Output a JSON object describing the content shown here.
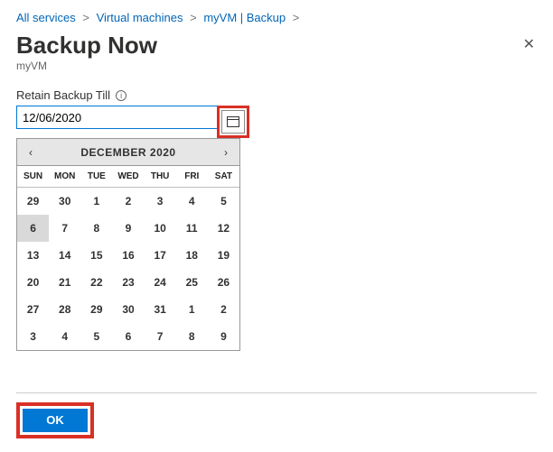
{
  "breadcrumb": {
    "items": [
      "All services",
      "Virtual machines",
      "myVM | Backup"
    ],
    "sep": ">"
  },
  "title": "Backup Now",
  "subtitle": "myVM",
  "close_label": "✕",
  "field": {
    "label": "Retain Backup Till",
    "info_glyph": "i",
    "value": "12/06/2020"
  },
  "calendar": {
    "month_label": "DECEMBER 2020",
    "prev_glyph": "‹",
    "next_glyph": "›",
    "dow": [
      "SUN",
      "MON",
      "TUE",
      "WED",
      "THU",
      "FRI",
      "SAT"
    ],
    "weeks": [
      [
        {
          "d": "29",
          "o": true
        },
        {
          "d": "30",
          "o": true
        },
        {
          "d": "1"
        },
        {
          "d": "2"
        },
        {
          "d": "3"
        },
        {
          "d": "4"
        },
        {
          "d": "5"
        }
      ],
      [
        {
          "d": "6",
          "sel": true
        },
        {
          "d": "7"
        },
        {
          "d": "8"
        },
        {
          "d": "9"
        },
        {
          "d": "10"
        },
        {
          "d": "11"
        },
        {
          "d": "12"
        }
      ],
      [
        {
          "d": "13"
        },
        {
          "d": "14"
        },
        {
          "d": "15"
        },
        {
          "d": "16"
        },
        {
          "d": "17"
        },
        {
          "d": "18"
        },
        {
          "d": "19"
        }
      ],
      [
        {
          "d": "20"
        },
        {
          "d": "21"
        },
        {
          "d": "22"
        },
        {
          "d": "23"
        },
        {
          "d": "24"
        },
        {
          "d": "25"
        },
        {
          "d": "26"
        }
      ],
      [
        {
          "d": "27"
        },
        {
          "d": "28"
        },
        {
          "d": "29"
        },
        {
          "d": "30"
        },
        {
          "d": "31"
        },
        {
          "d": "1",
          "o": true
        },
        {
          "d": "2",
          "o": true
        }
      ],
      [
        {
          "d": "3",
          "o": true
        },
        {
          "d": "4",
          "o": true
        },
        {
          "d": "5",
          "o": true
        },
        {
          "d": "6",
          "o": true
        },
        {
          "d": "7",
          "o": true
        },
        {
          "d": "8",
          "o": true
        },
        {
          "d": "9",
          "o": true
        }
      ]
    ]
  },
  "ok_label": "OK"
}
